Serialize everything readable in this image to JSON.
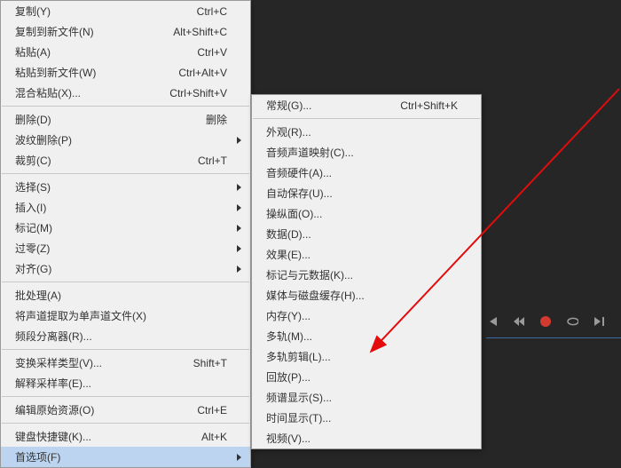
{
  "menu1": [
    {
      "label": "复制(Y)",
      "shortcut": "Ctrl+C",
      "sub": false
    },
    {
      "label": "复制到新文件(N)",
      "shortcut": "Alt+Shift+C",
      "sub": false
    },
    {
      "label": "粘贴(A)",
      "shortcut": "Ctrl+V",
      "sub": false
    },
    {
      "label": "粘贴到新文件(W)",
      "shortcut": "Ctrl+Alt+V",
      "sub": false
    },
    {
      "label": "混合粘贴(X)...",
      "shortcut": "Ctrl+Shift+V",
      "sub": false
    },
    "sep",
    {
      "label": "删除(D)",
      "shortcut": "删除",
      "sub": false
    },
    {
      "label": "波纹删除(P)",
      "shortcut": "",
      "sub": true
    },
    {
      "label": "裁剪(C)",
      "shortcut": "Ctrl+T",
      "sub": false
    },
    "sep",
    {
      "label": "选择(S)",
      "shortcut": "",
      "sub": true
    },
    {
      "label": "插入(I)",
      "shortcut": "",
      "sub": true
    },
    {
      "label": "标记(M)",
      "shortcut": "",
      "sub": true
    },
    {
      "label": "过零(Z)",
      "shortcut": "",
      "sub": true
    },
    {
      "label": "对齐(G)",
      "shortcut": "",
      "sub": true
    },
    "sep",
    {
      "label": "批处理(A)",
      "shortcut": "",
      "sub": false
    },
    {
      "label": "将声道提取为单声道文件(X)",
      "shortcut": "",
      "sub": false
    },
    {
      "label": "频段分离器(R)...",
      "shortcut": "",
      "sub": false
    },
    "sep",
    {
      "label": "变换采样类型(V)...",
      "shortcut": "Shift+T",
      "sub": false
    },
    {
      "label": "解释采样率(E)...",
      "shortcut": "",
      "sub": false
    },
    "sep",
    {
      "label": "编辑原始资源(O)",
      "shortcut": "Ctrl+E",
      "sub": false
    },
    "sep",
    {
      "label": "键盘快捷键(K)...",
      "shortcut": "Alt+K",
      "sub": false
    },
    {
      "label": "首选项(F)",
      "shortcut": "",
      "sub": true,
      "selected": true
    }
  ],
  "menu2": [
    {
      "label": "常规(G)...",
      "shortcut": "Ctrl+Shift+K"
    },
    "sep",
    {
      "label": "外观(R)..."
    },
    {
      "label": "音频声道映射(C)..."
    },
    {
      "label": "音频硬件(A)..."
    },
    {
      "label": "自动保存(U)..."
    },
    {
      "label": "操纵面(O)..."
    },
    {
      "label": "数据(D)..."
    },
    {
      "label": "效果(E)..."
    },
    {
      "label": "标记与元数据(K)..."
    },
    {
      "label": "媒体与磁盘缓存(H)..."
    },
    {
      "label": "内存(Y)..."
    },
    {
      "label": "多轨(M)..."
    },
    {
      "label": "多轨剪辑(L)..."
    },
    {
      "label": "回放(P)..."
    },
    {
      "label": "频谱显示(S)..."
    },
    {
      "label": "时间显示(T)..."
    },
    {
      "label": "视频(V)..."
    }
  ],
  "colors": {
    "record": "#d23a2f",
    "accent": "#3a6ea5",
    "icon": "#9a9a9a"
  }
}
